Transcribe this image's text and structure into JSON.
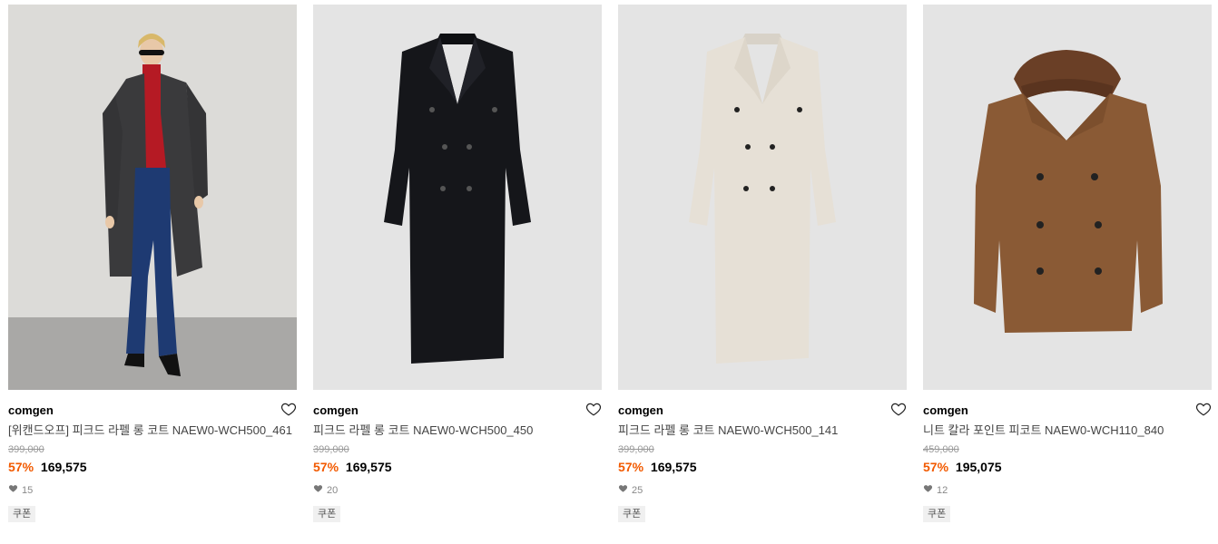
{
  "products": [
    {
      "brand": "comgen",
      "name": "[위캔드오프] 피크드 라펠 롱 코트 NAEW0-WCH500_461",
      "original_price": "399,000",
      "discount": "57%",
      "price": "169,575",
      "likes": "15",
      "badge": "쿠폰",
      "coat_color": "#3a3a3c",
      "image_bg": "#dcdbd8"
    },
    {
      "brand": "comgen",
      "name": "피크드 라펠 롱 코트 NAEW0-WCH500_450",
      "original_price": "399,000",
      "discount": "57%",
      "price": "169,575",
      "likes": "20",
      "badge": "쿠폰",
      "coat_color": "#15161a",
      "image_bg": "#e4e4e4"
    },
    {
      "brand": "comgen",
      "name": "피크드 라펠 롱 코트 NAEW0-WCH500_141",
      "original_price": "399,000",
      "discount": "57%",
      "price": "169,575",
      "likes": "25",
      "badge": "쿠폰",
      "coat_color": "#e6e0d6",
      "image_bg": "#e4e4e4"
    },
    {
      "brand": "comgen",
      "name": "니트 칼라 포인트 피코트 NAEW0-WCH110_840",
      "original_price": "459,000",
      "discount": "57%",
      "price": "195,075",
      "likes": "12",
      "badge": "쿠폰",
      "coat_color": "#8a5a35",
      "image_bg": "#e4e4e4"
    }
  ],
  "icons": {
    "wishlist": "heart-outline-icon",
    "likes": "heart-filled-icon"
  },
  "colors": {
    "discount": "#f25a00",
    "original_price": "#999999",
    "badge_bg": "#f0f0f0"
  }
}
